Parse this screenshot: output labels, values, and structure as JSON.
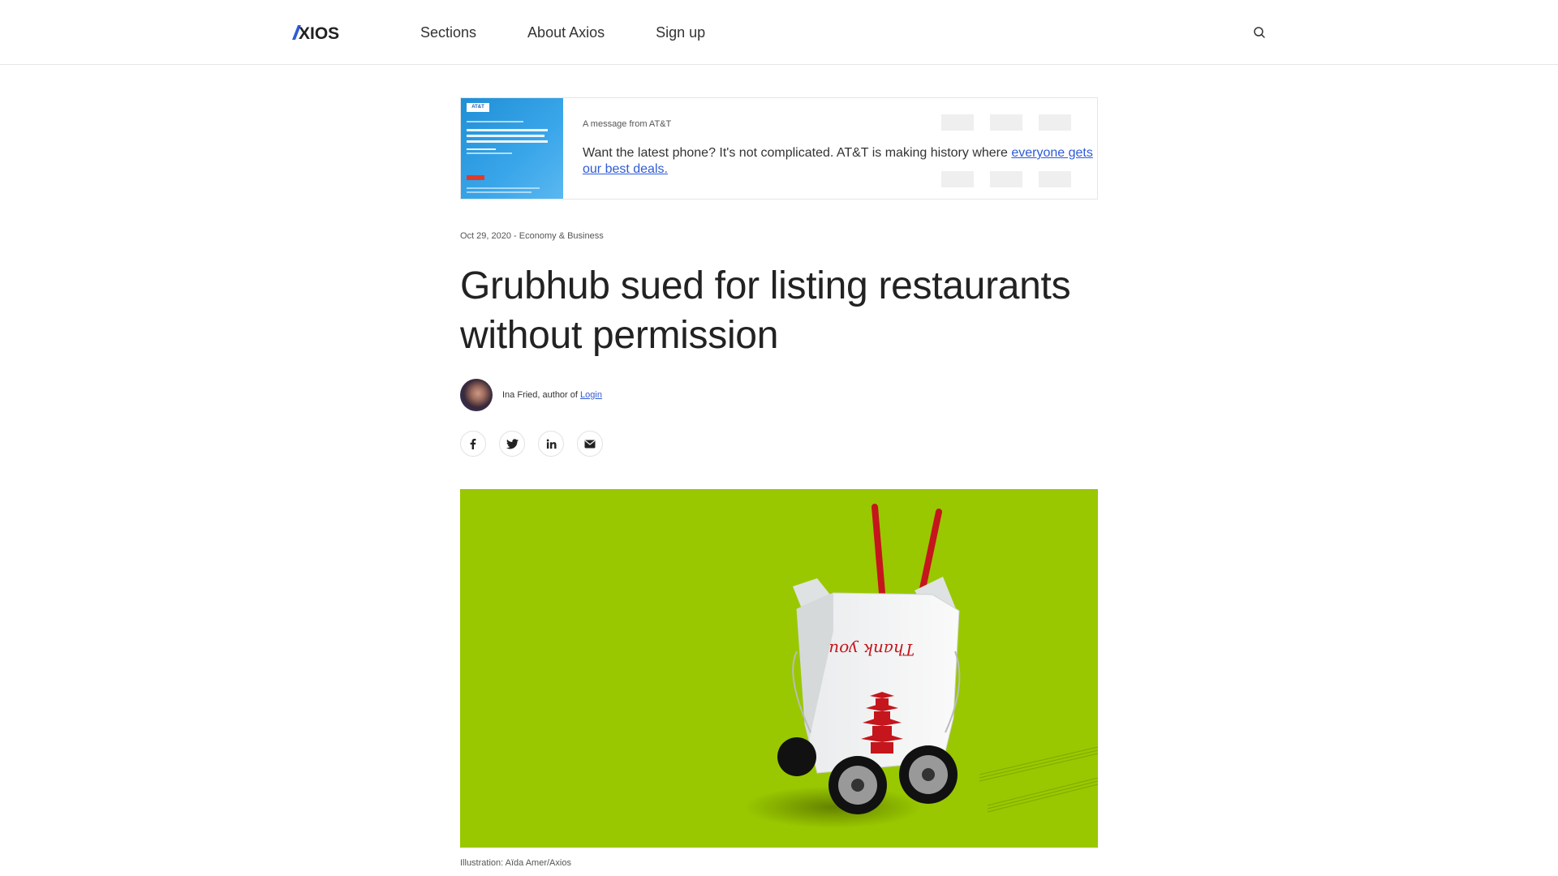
{
  "header": {
    "logo": "AXIOS",
    "nav": [
      "Sections",
      "About Axios",
      "Sign up"
    ],
    "search_icon": "search-icon"
  },
  "ad": {
    "image_brand": "AT&T",
    "label": "A message from AT&T",
    "text": "Want the latest phone? It's not complicated. AT&T is making history where",
    "link_text": "everyone gets our best deals."
  },
  "article": {
    "date": "Oct 29, 2020",
    "separator": " - ",
    "category": "Economy & Business",
    "title": "Grubhub sued for listing restaurants without permission",
    "author": "Ina Fried, author of",
    "author_link": "Login",
    "share_icons": [
      "facebook-icon",
      "twitter-icon",
      "linkedin-icon",
      "email-icon"
    ],
    "image_text": "Thank you",
    "caption": "Illustration: Aïda Amer/Axios"
  },
  "colors": {
    "accent": "#2f5bd5",
    "hero_bg": "#99c800",
    "chopsticks": "#c4161c"
  }
}
